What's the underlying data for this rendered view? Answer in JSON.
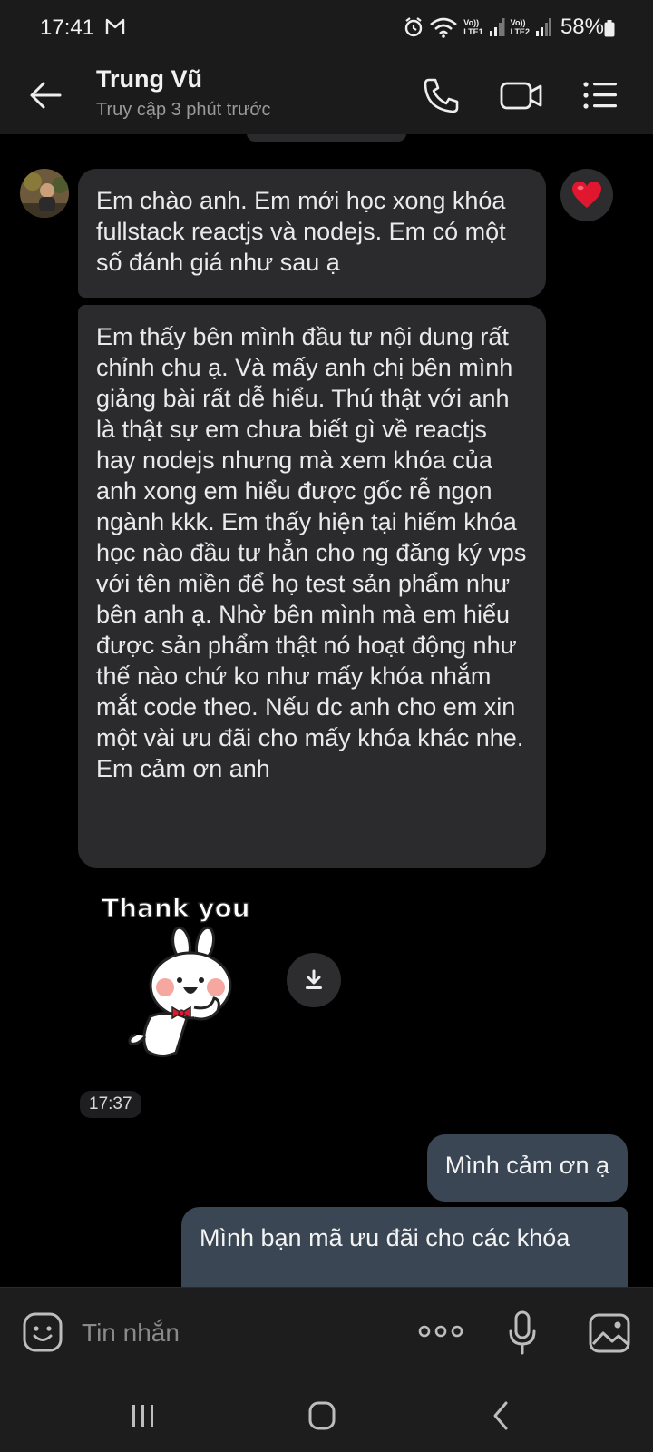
{
  "status_bar": {
    "time": "17:41",
    "sim1": "LTE1",
    "sim2": "LTE2",
    "volte": "Vo))",
    "battery": "58%"
  },
  "header": {
    "contact_name": "Trung Vũ",
    "presence": "Truy cập 3 phút trước",
    "icons": [
      "back-arrow-icon",
      "phone-icon",
      "video-call-icon",
      "menu-list-icon"
    ]
  },
  "messages": {
    "incoming": [
      "Em chào anh. Em mới học xong khóa fullstack reactjs và nodejs. Em có một số đánh giá như sau ạ",
      "Em thấy bên mình đầu tư nội dung rất chỉnh chu ạ. Và mấy anh chị bên mình giảng bài rất dễ hiểu. Thú thật với anh là thật sự em chưa biết gì về reactjs hay nodejs nhưng mà xem khóa của anh xong em hiểu được gốc rễ ngọn ngành kkk. Em thấy hiện tại hiếm khóa học nào đầu tư hẳn cho ng đăng ký vps với tên miền để họ test sản phẩm như bên anh ạ. Nhờ bên mình mà em hiểu được sản phẩm thật nó hoạt động như thế nào chứ ko như mấy khóa nhắm mắt code theo. Nếu dc anh cho em xin một vài ưu đãi cho mấy khóa khác nhe. Em cảm ơn anh"
    ],
    "reaction": "heart",
    "sticker_text": "Thank you",
    "timestamp": "17:37",
    "outgoing": [
      "Mình cảm ơn ạ",
      "Mình bạn mã ưu đãi cho các khóa"
    ]
  },
  "composer": {
    "placeholder": "Tin nhắn"
  },
  "colors": {
    "background": "#000000",
    "bar": "#1b1b1c",
    "incoming_bubble": "#2b2b2d",
    "outgoing_bubble": "#3a4654",
    "heart": "#e0172f"
  }
}
